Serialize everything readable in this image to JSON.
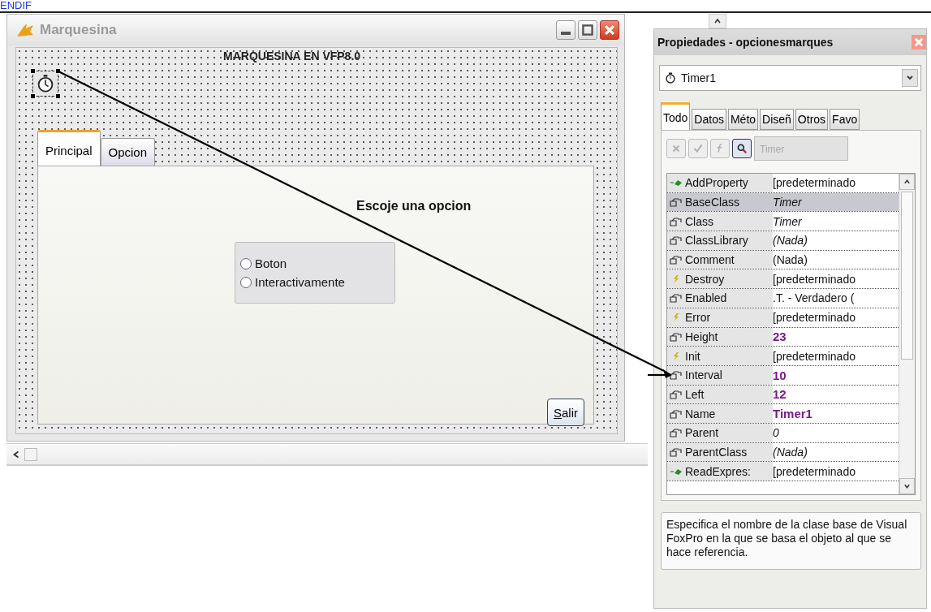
{
  "top_text": "ENDIF",
  "designer": {
    "title": "Marquesina",
    "form": {
      "caption_label": "MARQUESINA EN VFP8.0",
      "tabs": [
        {
          "label": "Principal",
          "selected": true
        },
        {
          "label": "Opcion",
          "selected": false
        }
      ],
      "prompt": "Escoje una opcion",
      "options": [
        {
          "label": "Boton",
          "selected": false
        },
        {
          "label": "Interactivamente",
          "selected": false
        }
      ],
      "exit_button": "Salir"
    }
  },
  "properties": {
    "title": "Propiedades - opcionesmarques",
    "object": "Timer1",
    "tabs": [
      {
        "label": "Todo",
        "selected": true
      },
      {
        "label": "Datos",
        "selected": false
      },
      {
        "label": "Méto",
        "selected": false
      },
      {
        "label": "Diseñ",
        "selected": false
      },
      {
        "label": "Otros",
        "selected": false
      },
      {
        "label": "Favo",
        "selected": false
      }
    ],
    "tools": [
      {
        "kind": "cancel",
        "disabled": true
      },
      {
        "kind": "accept",
        "disabled": true
      },
      {
        "kind": "function",
        "disabled": true
      },
      {
        "kind": "zoom",
        "disabled": false
      }
    ],
    "value_field": "Timer",
    "rows": [
      {
        "kind": "method",
        "name": "AddProperty",
        "value": "[predeterminado",
        "readonly": false,
        "modified": false,
        "selected": false
      },
      {
        "kind": "property",
        "name": "BaseClass",
        "value": "Timer",
        "readonly": true,
        "modified": false,
        "selected": true
      },
      {
        "kind": "property",
        "name": "Class",
        "value": "Timer",
        "readonly": true,
        "modified": false,
        "selected": false
      },
      {
        "kind": "property",
        "name": "ClassLibrary",
        "value": "(Nada)",
        "readonly": true,
        "modified": false,
        "selected": false
      },
      {
        "kind": "property",
        "name": "Comment",
        "value": "(Nada)",
        "readonly": false,
        "modified": false,
        "selected": false
      },
      {
        "kind": "event",
        "name": "Destroy",
        "value": "[predeterminado",
        "readonly": false,
        "modified": false,
        "selected": false
      },
      {
        "kind": "property",
        "name": "Enabled",
        "value": ".T. - Verdadero (",
        "readonly": false,
        "modified": false,
        "selected": false
      },
      {
        "kind": "event",
        "name": "Error",
        "value": "[predeterminado",
        "readonly": false,
        "modified": false,
        "selected": false
      },
      {
        "kind": "property",
        "name": "Height",
        "value": "23",
        "readonly": false,
        "modified": true,
        "selected": false
      },
      {
        "kind": "event",
        "name": "Init",
        "value": "[predeterminado",
        "readonly": false,
        "modified": false,
        "selected": false
      },
      {
        "kind": "property",
        "name": "Interval",
        "value": "10",
        "readonly": false,
        "modified": true,
        "selected": false
      },
      {
        "kind": "property",
        "name": "Left",
        "value": "12",
        "readonly": false,
        "modified": true,
        "selected": false
      },
      {
        "kind": "property",
        "name": "Name",
        "value": "Timer1",
        "readonly": false,
        "modified": true,
        "selected": false
      },
      {
        "kind": "property",
        "name": "Parent",
        "value": "0",
        "readonly": true,
        "modified": false,
        "selected": false
      },
      {
        "kind": "property",
        "name": "ParentClass",
        "value": "(Nada)",
        "readonly": true,
        "modified": false,
        "selected": false
      },
      {
        "kind": "method",
        "name": "ReadExpres:",
        "value": "[predeterminado",
        "readonly": false,
        "modified": false,
        "selected": false
      }
    ],
    "description": "Especifica el nombre de la clase base de Visual FoxPro en la que se basa el objeto al que se hace referencia."
  }
}
